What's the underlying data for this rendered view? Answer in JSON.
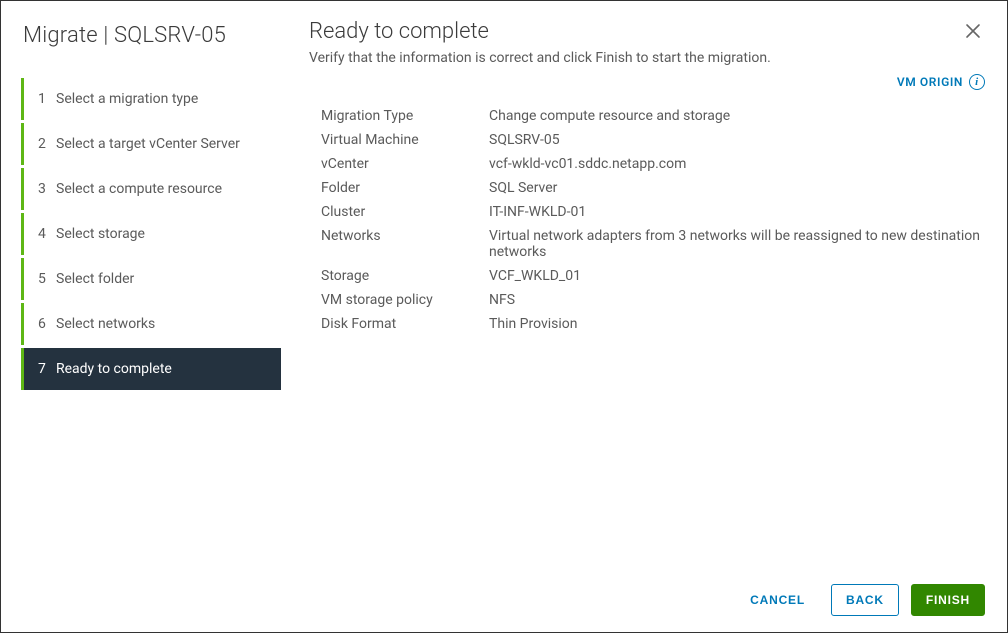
{
  "header": {
    "title_prefix": "Migrate",
    "title_separator": "|",
    "title_vm": "SQLSRV-05"
  },
  "steps": [
    {
      "num": "1",
      "label": "Select a migration type"
    },
    {
      "num": "2",
      "label": "Select a target vCenter Server"
    },
    {
      "num": "3",
      "label": "Select a compute resource"
    },
    {
      "num": "4",
      "label": "Select storage"
    },
    {
      "num": "5",
      "label": "Select folder"
    },
    {
      "num": "6",
      "label": "Select networks"
    },
    {
      "num": "7",
      "label": "Ready to complete"
    }
  ],
  "main": {
    "title": "Ready to complete",
    "subtitle": "Verify that the information is correct and click Finish to start the migration.",
    "vm_origin_label": "VM ORIGIN"
  },
  "summary": [
    {
      "label": "Migration Type",
      "value": "Change compute resource and storage"
    },
    {
      "label": "Virtual Machine",
      "value": "SQLSRV-05"
    },
    {
      "label": "vCenter",
      "value": "vcf-wkld-vc01.sddc.netapp.com"
    },
    {
      "label": "Folder",
      "value": "SQL Server"
    },
    {
      "label": "Cluster",
      "value": "IT-INF-WKLD-01"
    },
    {
      "label": "Networks",
      "value": "Virtual network adapters from 3 networks will be reassigned to new destination networks"
    },
    {
      "label": "Storage",
      "value": "VCF_WKLD_01"
    },
    {
      "label": "VM storage policy",
      "value": "NFS"
    },
    {
      "label": "Disk Format",
      "value": "Thin Provision"
    }
  ],
  "footer": {
    "cancel": "CANCEL",
    "back": "BACK",
    "finish": "FINISH"
  }
}
